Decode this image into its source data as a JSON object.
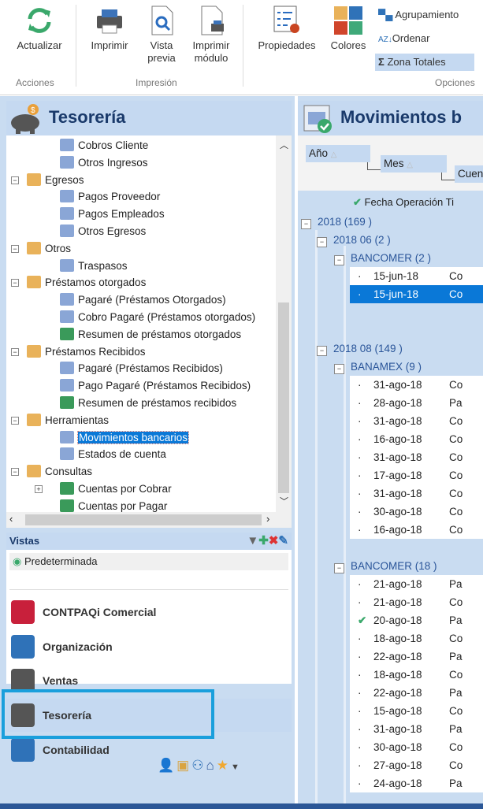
{
  "ribbon": {
    "actualizar": "Actualizar",
    "imprimir": "Imprimir",
    "vista_previa": "Vista previa",
    "imprimir_modulo": "Imprimir módulo",
    "propiedades": "Propiedades",
    "colores": "Colores",
    "agrupamiento": "Agrupamiento",
    "ordenar": "Ordenar",
    "zona_totales": "Zona Totales",
    "groups": {
      "acciones": "Acciones",
      "impresion": "Impresión",
      "opciones": "Opciones"
    }
  },
  "left_panel": {
    "title": "Tesorería",
    "tree": [
      {
        "label": "Cobros Cliente",
        "level": 2,
        "icon": "customer-payment-icon"
      },
      {
        "label": "Otros Ingresos",
        "level": 2,
        "icon": "other-income-icon"
      },
      {
        "label": "Egresos",
        "level": 1,
        "icon": "folder-icon",
        "expanded": true
      },
      {
        "label": "Pagos Proveedor",
        "level": 2,
        "icon": "supplier-payment-icon"
      },
      {
        "label": "Pagos Empleados",
        "level": 2,
        "icon": "employee-payment-icon"
      },
      {
        "label": "Otros Egresos",
        "level": 2,
        "icon": "other-expense-icon"
      },
      {
        "label": "Otros",
        "level": 1,
        "icon": "folder-icon",
        "expanded": true
      },
      {
        "label": "Traspasos",
        "level": 2,
        "icon": "transfer-icon"
      },
      {
        "label": "Préstamos otorgados",
        "level": 1,
        "icon": "folder-icon",
        "expanded": true
      },
      {
        "label": "Pagaré (Préstamos Otorgados)",
        "level": 2,
        "icon": "promissory-note-icon"
      },
      {
        "label": "Cobro Pagaré (Préstamos otorgados)",
        "level": 2,
        "icon": "note-collection-icon"
      },
      {
        "label": "Resumen de préstamos otorgados",
        "level": 2,
        "icon": "grid-icon"
      },
      {
        "label": "Préstamos Recibidos",
        "level": 1,
        "icon": "folder-icon",
        "expanded": true
      },
      {
        "label": "Pagaré (Préstamos Recibidos)",
        "level": 2,
        "icon": "promissory-note-icon"
      },
      {
        "label": "Pago Pagaré (Préstamos Recibidos)",
        "level": 2,
        "icon": "note-payment-icon"
      },
      {
        "label": "Resumen de préstamos recibidos",
        "level": 2,
        "icon": "grid-icon"
      },
      {
        "label": "Herramientas",
        "level": 1,
        "icon": "folder-icon",
        "expanded": true
      },
      {
        "label": "Movimientos bancarios",
        "level": 2,
        "icon": "bank-movements-icon",
        "selected": true
      },
      {
        "label": "Estados de cuenta",
        "level": 2,
        "icon": "statement-icon"
      },
      {
        "label": "Consultas",
        "level": 1,
        "icon": "folder-icon",
        "expanded": true
      },
      {
        "label": "Cuentas por Cobrar",
        "level": 2,
        "icon": "grid-icon",
        "expandable": true
      },
      {
        "label": "Cuentas por Pagar",
        "level": 2,
        "icon": "grid-icon"
      }
    ],
    "vistas_title": "Vistas",
    "view_selected": "Predeterminada",
    "nav": [
      {
        "label": "CONTPAQi Comercial",
        "icon": "contpaqi-icon"
      },
      {
        "label": "Organización",
        "icon": "building-icon"
      },
      {
        "label": "Ventas",
        "icon": "person-icon"
      },
      {
        "label": "Tesorería",
        "icon": "piggy-bank-icon",
        "active": true
      },
      {
        "label": "Contabilidad",
        "icon": "binders-icon"
      }
    ]
  },
  "main": {
    "title": "Movimientos b",
    "group_by": [
      "Año",
      "Mes",
      "Cuen"
    ],
    "col_header": "Fecha Operación",
    "col_header2": "Ti",
    "rows": [
      {
        "type": "g1",
        "text": "2018 (169 )"
      },
      {
        "type": "g2",
        "text": "2018 06 (2 )"
      },
      {
        "type": "g3",
        "text": "BANCOMER (2 )"
      },
      {
        "type": "d",
        "date": "15-jun-18",
        "t": "Co"
      },
      {
        "type": "d",
        "date": "15-jun-18",
        "t": "Co",
        "selected": true
      },
      {
        "type": "gap"
      },
      {
        "type": "gap"
      },
      {
        "type": "g2",
        "text": "2018 08 (149 )"
      },
      {
        "type": "g3",
        "text": "BANAMEX (9 )"
      },
      {
        "type": "d",
        "date": "31-ago-18",
        "t": "Co"
      },
      {
        "type": "d",
        "date": "28-ago-18",
        "t": "Pa"
      },
      {
        "type": "d",
        "date": "31-ago-18",
        "t": "Co"
      },
      {
        "type": "d",
        "date": "16-ago-18",
        "t": "Co"
      },
      {
        "type": "d",
        "date": "31-ago-18",
        "t": "Co"
      },
      {
        "type": "d",
        "date": "17-ago-18",
        "t": "Co"
      },
      {
        "type": "d",
        "date": "31-ago-18",
        "t": "Co"
      },
      {
        "type": "d",
        "date": "30-ago-18",
        "t": "Co"
      },
      {
        "type": "d",
        "date": "16-ago-18",
        "t": "Co"
      },
      {
        "type": "gap"
      },
      {
        "type": "g3",
        "text": "BANCOMER (18 )"
      },
      {
        "type": "d",
        "date": "21-ago-18",
        "t": "Pa"
      },
      {
        "type": "d",
        "date": "21-ago-18",
        "t": "Co"
      },
      {
        "type": "d",
        "date": "20-ago-18",
        "t": "Pa",
        "checked": true
      },
      {
        "type": "d",
        "date": "18-ago-18",
        "t": "Co"
      },
      {
        "type": "d",
        "date": "22-ago-18",
        "t": "Pa"
      },
      {
        "type": "d",
        "date": "18-ago-18",
        "t": "Co"
      },
      {
        "type": "d",
        "date": "22-ago-18",
        "t": "Pa"
      },
      {
        "type": "d",
        "date": "15-ago-18",
        "t": "Co"
      },
      {
        "type": "d",
        "date": "31-ago-18",
        "t": "Pa"
      },
      {
        "type": "d",
        "date": "30-ago-18",
        "t": "Co"
      },
      {
        "type": "d",
        "date": "27-ago-18",
        "t": "Co"
      },
      {
        "type": "d",
        "date": "24-ago-18",
        "t": "Pa"
      }
    ]
  },
  "colors": {
    "accent": "#0a78d7",
    "panel": "#c5d9f1",
    "highlight": "#1a9fdc",
    "check": "#3aa86b"
  }
}
